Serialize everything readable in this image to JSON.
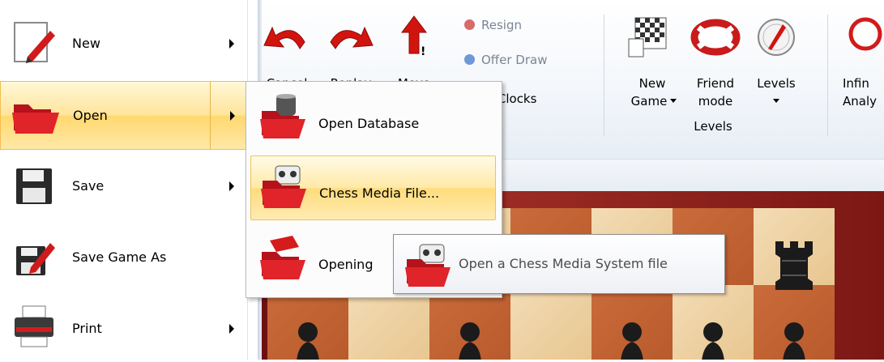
{
  "ribbon": {
    "undo_label": "Cancel",
    "redo_label": "Replay",
    "move_label": "Move",
    "resign_label": "Resign",
    "offer_draw_label": "Offer Draw",
    "stop_clocks_label": "Stop Clocks",
    "new_game_label_1": "New",
    "new_game_label_2": "Game",
    "friend_mode_label_1": "Friend",
    "friend_mode_label_2": "mode",
    "levels_label": "Levels",
    "group_levels_label": "Levels",
    "infinite_label_1": "Infin",
    "infinite_label_2": "Analy"
  },
  "menu": {
    "items": [
      {
        "label": "New",
        "icon": "pencil-document-icon",
        "has_submenu": true
      },
      {
        "label": "Open",
        "icon": "folder-open-icon",
        "has_submenu": true,
        "highlighted": true
      },
      {
        "label": "Save",
        "icon": "floppy-disk-icon",
        "has_submenu": true
      },
      {
        "label": "Save Game As",
        "icon": "floppy-pencil-icon",
        "has_submenu": false
      },
      {
        "label": "Print",
        "icon": "printer-icon",
        "has_submenu": true
      }
    ]
  },
  "submenu": {
    "items": [
      {
        "label": "Open Database",
        "icon": "database-folder-icon"
      },
      {
        "label": "Chess Media File...",
        "icon": "media-folder-icon",
        "highlighted": true
      },
      {
        "label": "Opening",
        "icon": "book-folder-icon"
      }
    ]
  },
  "tooltip": {
    "text": "Open a Chess Media System file",
    "icon": "media-folder-icon"
  },
  "colors": {
    "highlight": "#ffe49a",
    "highlight_border": "#f0c050",
    "folder_red": "#c8161d",
    "board_frame": "#8a1f1a"
  }
}
